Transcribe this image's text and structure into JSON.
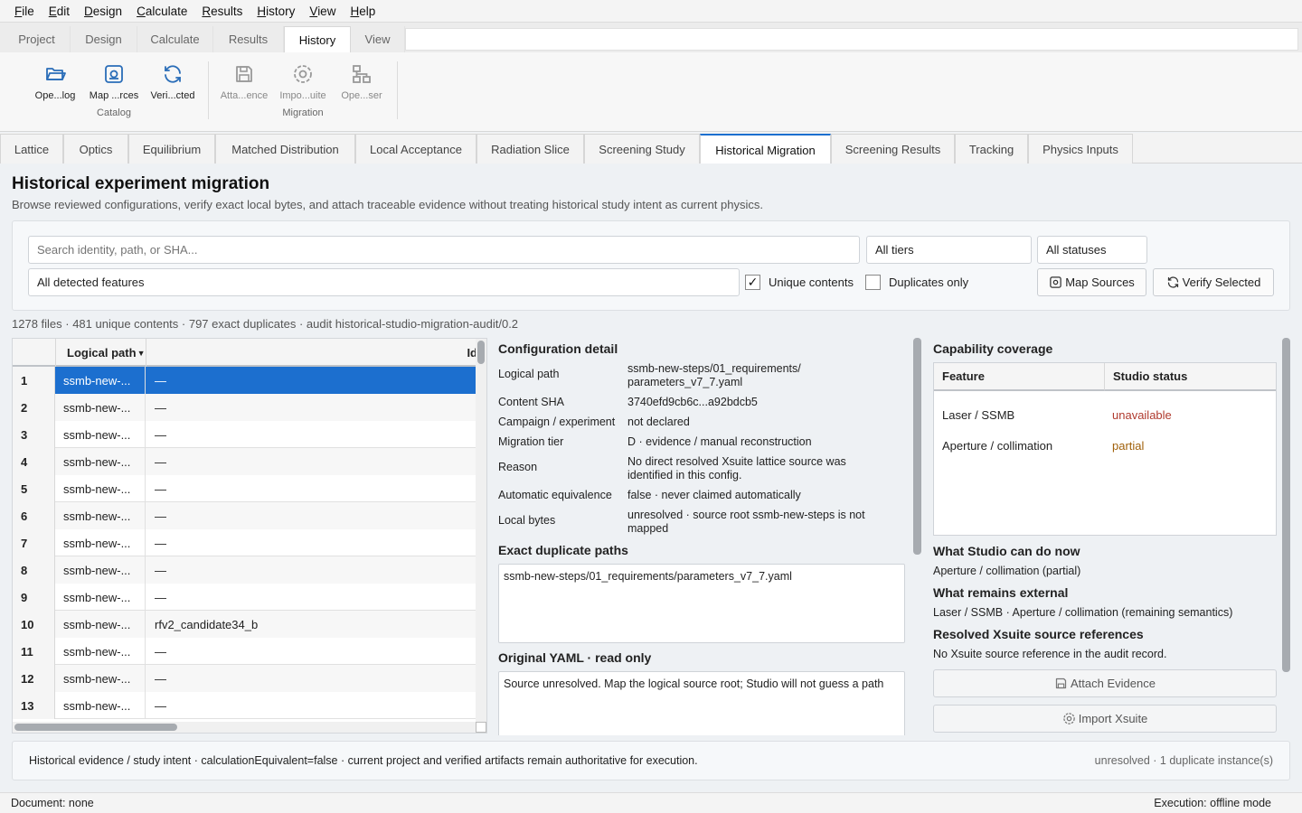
{
  "menu": [
    "File",
    "Edit",
    "Design",
    "Calculate",
    "Results",
    "History",
    "View",
    "Help"
  ],
  "ribbon_tabs": [
    {
      "label": "Project",
      "active": false
    },
    {
      "label": "Design",
      "active": false
    },
    {
      "label": "Calculate",
      "active": false
    },
    {
      "label": "Results",
      "active": false
    },
    {
      "label": "History",
      "active": true
    },
    {
      "label": "View",
      "active": false
    }
  ],
  "ribbon": {
    "buttons": [
      {
        "label": "Ope...log",
        "icon": "folder-open-icon",
        "enabled": true
      },
      {
        "label": "Map ...rces",
        "icon": "map-sources-icon",
        "enabled": true
      },
      {
        "label": "Veri...cted",
        "icon": "refresh-icon",
        "enabled": true
      },
      {
        "label": "Atta...ence",
        "icon": "save-icon",
        "enabled": false
      },
      {
        "label": "Impo...uite",
        "icon": "import-icon",
        "enabled": false
      },
      {
        "label": "Ope...ser",
        "icon": "hierarchy-icon",
        "enabled": false
      }
    ],
    "groups": [
      "Catalog",
      "Migration"
    ]
  },
  "doc_tabs": [
    {
      "label": "Lattice",
      "active": false
    },
    {
      "label": "Optics",
      "active": false
    },
    {
      "label": "Equilibrium",
      "active": false
    },
    {
      "label": "Matched Distribution",
      "active": false
    },
    {
      "label": "Local Acceptance",
      "active": false
    },
    {
      "label": "Radiation Slice",
      "active": false
    },
    {
      "label": "Screening Study",
      "active": false
    },
    {
      "label": "Historical Migration",
      "active": true
    },
    {
      "label": "Screening Results",
      "active": false
    },
    {
      "label": "Tracking",
      "active": false
    },
    {
      "label": "Physics Inputs",
      "active": false
    }
  ],
  "page": {
    "title": "Historical experiment migration",
    "subtitle": "Browse reviewed configurations, verify exact local bytes, and attach traceable evidence without treating historical study intent as current physics."
  },
  "filters": {
    "search_placeholder": "Search identity, path, or SHA...",
    "tier": "All tiers",
    "status": "All statuses",
    "features": "All detected features",
    "unique_contents_label": "Unique contents",
    "unique_contents_checked": true,
    "duplicates_only_label": "Duplicates only",
    "duplicates_only_checked": false,
    "map_sources_label": "Map Sources",
    "verify_selected_label": "Verify Selected"
  },
  "summary": "1278 files · 481 unique contents · 797 exact duplicates · audit historical-studio-migration-audit/0.2",
  "table": {
    "columns": [
      "Logical path",
      "Id"
    ],
    "rows": [
      {
        "num": "1",
        "path": "ssmb-new-...",
        "id": "—",
        "selected": true
      },
      {
        "num": "2",
        "path": "ssmb-new-...",
        "id": "—",
        "selected": false
      },
      {
        "num": "3",
        "path": "ssmb-new-...",
        "id": "—",
        "selected": false
      },
      {
        "num": "4",
        "path": "ssmb-new-...",
        "id": "—",
        "selected": false
      },
      {
        "num": "5",
        "path": "ssmb-new-...",
        "id": "—",
        "selected": false
      },
      {
        "num": "6",
        "path": "ssmb-new-...",
        "id": "—",
        "selected": false
      },
      {
        "num": "7",
        "path": "ssmb-new-...",
        "id": "—",
        "selected": false
      },
      {
        "num": "8",
        "path": "ssmb-new-...",
        "id": "—",
        "selected": false
      },
      {
        "num": "9",
        "path": "ssmb-new-...",
        "id": "—",
        "selected": false
      },
      {
        "num": "10",
        "path": "ssmb-new-...",
        "id": "rfv2_candidate34_b",
        "selected": false
      },
      {
        "num": "11",
        "path": "ssmb-new-...",
        "id": "—",
        "selected": false
      },
      {
        "num": "12",
        "path": "ssmb-new-...",
        "id": "—",
        "selected": false
      },
      {
        "num": "13",
        "path": "ssmb-new-...",
        "id": "—",
        "selected": false
      }
    ]
  },
  "detail": {
    "title": "Configuration detail",
    "fields": [
      {
        "key": "Logical path",
        "value": "ssmb-new-steps/01_requirements/ parameters_v7_7.yaml"
      },
      {
        "key": "Content SHA",
        "value": "3740efd9cb6c...a92bdcb5"
      },
      {
        "key": "Campaign / experiment",
        "value": "not declared"
      },
      {
        "key": "Migration tier",
        "value": "D · evidence / manual reconstruction"
      },
      {
        "key": "Reason",
        "value": "No direct resolved Xsuite lattice source was identified in this config."
      },
      {
        "key": "Automatic equivalence",
        "value": "false · never claimed automatically"
      },
      {
        "key": "Local bytes",
        "value": "unresolved · source root ssmb-new-steps is not mapped"
      }
    ],
    "duplicates_title": "Exact duplicate paths",
    "duplicates_text": "ssmb-new-steps/01_requirements/parameters_v7_7.yaml",
    "yaml_title": "Original YAML · read only",
    "yaml_text": "Source unresolved. Map the logical source root; Studio will not guess a path"
  },
  "capability": {
    "title": "Capability coverage",
    "columns": [
      "Feature",
      "Studio status"
    ],
    "rows": [
      {
        "feature": "Laser / SSMB",
        "status": "unavailable",
        "color": "#b03a2e"
      },
      {
        "feature": "Aperture / collimation",
        "status": "partial",
        "color": "#a0600a"
      }
    ],
    "can_do_title": "What Studio can do now",
    "can_do_text": "Aperture / collimation (partial)",
    "external_title": "What remains external",
    "external_text": "Laser / SSMB · Aperture / collimation (remaining semantics)",
    "refs_title": "Resolved Xsuite source references",
    "refs_text": "No Xsuite source reference in the audit record.",
    "attach_label": "Attach Evidence",
    "import_label": "Import Xsuite"
  },
  "footnote": {
    "left": "Historical evidence / study intent · calculationEquivalent=false · current project and verified artifacts remain authoritative for execution.",
    "right": "unresolved · 1 duplicate instance(s)"
  },
  "status": {
    "left": "Document: none",
    "right": "Execution: offline mode"
  },
  "colors": {
    "accent": "#1c6fcf",
    "unavailable": "#b03a2e",
    "partial": "#a0600a"
  }
}
